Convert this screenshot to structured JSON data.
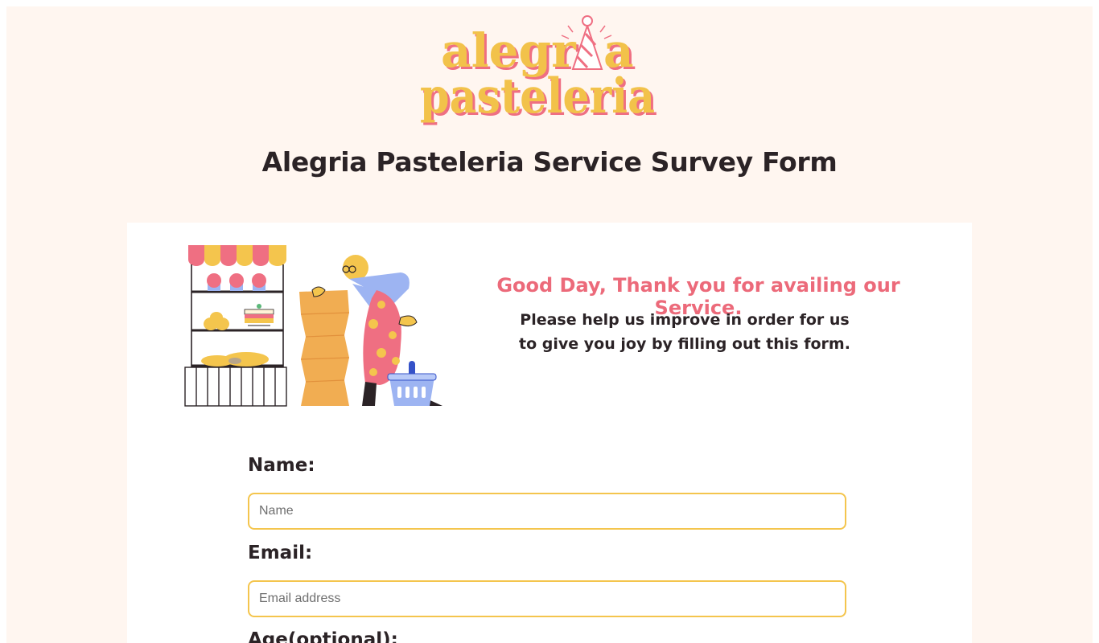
{
  "brand": {
    "logo_line1": "alegria",
    "logo_line2": "pasteleria",
    "colors": {
      "yellow": "#f2c24a",
      "pink": "#ef6f82",
      "background": "#fff6f0"
    }
  },
  "header": {
    "title": "Alegria Pasteleria Service Survey Form"
  },
  "intro": {
    "greeting": "Good Day, Thank you for availing our Service.",
    "line1": "Please help us improve in order for us",
    "line2": "to give you joy by filling out this form."
  },
  "form": {
    "name_label": "Name:",
    "name_placeholder": "Name",
    "email_label": "Email:",
    "email_placeholder": "Email address",
    "age_label": "Age(optional):"
  }
}
